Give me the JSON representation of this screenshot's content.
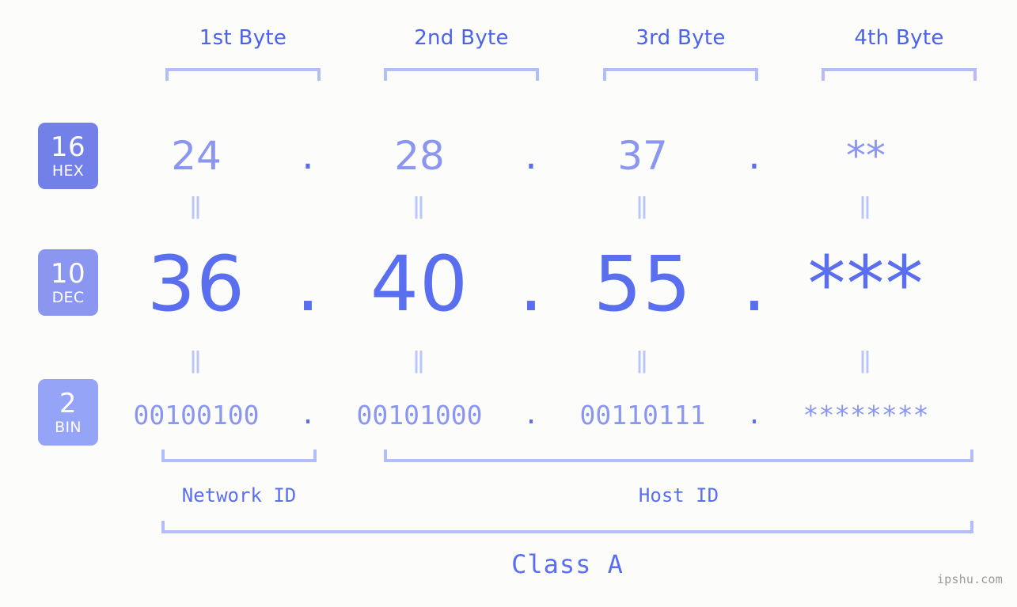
{
  "meta": {
    "watermark": "ipshu.com",
    "background_color": "#fcfdfa",
    "accent_primary": "#5a6ef0",
    "accent_light": "#8b96f0",
    "accent_pale": "#b3bdfb"
  },
  "byte_headers": [
    {
      "label": "1st Byte"
    },
    {
      "label": "2nd Byte"
    },
    {
      "label": "3rd Byte"
    },
    {
      "label": "4th Byte"
    }
  ],
  "bases": [
    {
      "id": "hex",
      "number": "16",
      "name": "HEX",
      "badge_color": "#7380e8"
    },
    {
      "id": "dec",
      "number": "10",
      "name": "DEC",
      "badge_color": "#8b96f0"
    },
    {
      "id": "bin",
      "number": "2",
      "name": "BIN",
      "badge_color": "#96a4f7"
    }
  ],
  "rows": {
    "hex": {
      "values": [
        "24",
        "28",
        "37",
        "**"
      ],
      "separator": "."
    },
    "dec": {
      "values": [
        "36",
        "40",
        "55",
        "***"
      ],
      "separator": "."
    },
    "bin": {
      "values": [
        "00100100",
        "00101000",
        "00110111",
        "********"
      ],
      "separator": "."
    }
  },
  "equality_marks": {
    "mark": "ǁ",
    "rows": [
      "hex-to-dec",
      "dec-to-bin"
    ]
  },
  "sections": {
    "network_id": "Network ID",
    "host_id": "Host ID",
    "class": "Class A"
  }
}
